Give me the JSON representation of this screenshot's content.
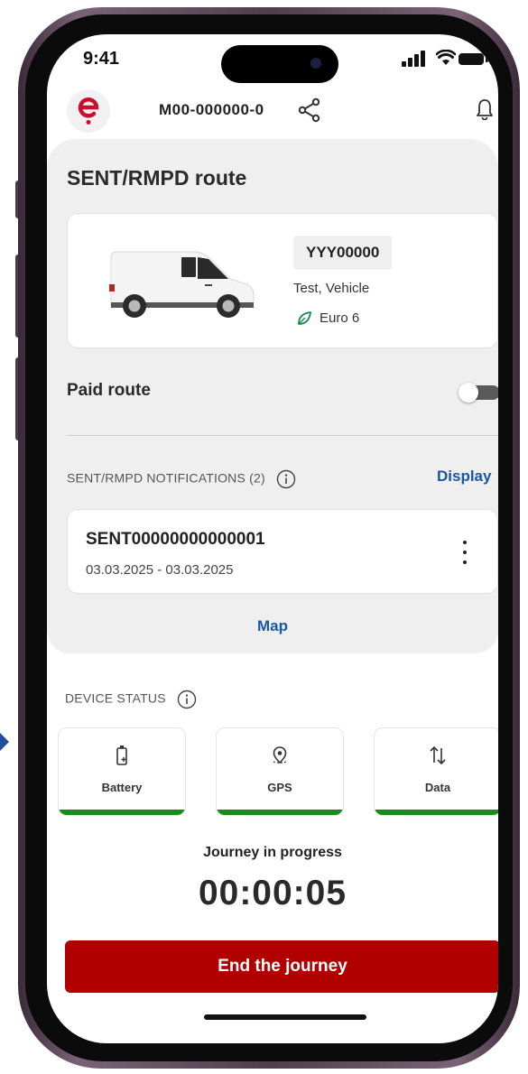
{
  "status_bar": {
    "time": "9:41"
  },
  "header": {
    "device_id": "M00-000000-0"
  },
  "route": {
    "title": "SENT/RMPD route"
  },
  "vehicle": {
    "plate": "YYY00000",
    "owner": "Test, Vehicle",
    "emission_class": "Euro 6"
  },
  "paid_route": {
    "label": "Paid route",
    "enabled": false
  },
  "notifications": {
    "heading": "SENT/RMPD NOTIFICATIONS (2)",
    "display_label": "Display",
    "items": [
      {
        "id": "SENT00000000000001",
        "dates": "03.03.2025 - 03.03.2025"
      }
    ]
  },
  "map_label": "Map",
  "device_status": {
    "heading": "DEVICE STATUS",
    "items": [
      {
        "label": "Battery",
        "icon": "battery-icon"
      },
      {
        "label": "GPS",
        "icon": "gps-icon"
      },
      {
        "label": "Data",
        "icon": "data-transfer-icon"
      }
    ]
  },
  "journey": {
    "status": "Journey in progress",
    "timer": "00:00:05",
    "end_label": "End the journey"
  },
  "colors": {
    "brand_red": "#c8102e",
    "link_blue": "#1a56a6",
    "end_button": "#b00000",
    "status_ok": "#1a8a1a",
    "panel_grey": "#efefef"
  }
}
